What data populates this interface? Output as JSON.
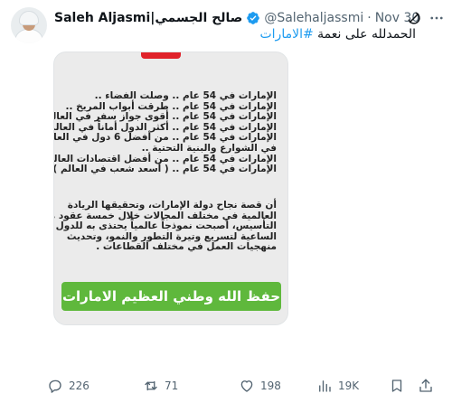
{
  "tweet": {
    "author_name": "Saleh Aljasmi|صالح الجسمي",
    "handle": "@Salehaljassmi",
    "separator": "·",
    "date": "Nov 30",
    "text_prefix": "الحمدلله على نعمة",
    "hashtag": "#الامارات"
  },
  "card": {
    "lines": [
      "الإمارات في 54 عام .. وصلت الفضاء ..",
      "الإمارات في 54 عام .. طرقت أبواب المريخ ..",
      "الإمارات في 54 عام .. أقوى جواز سفر في العالم ..",
      "الإمارات في 54 عام .. أكثر الدول أماناً في العالم ..",
      "الإمارات في 54 عام .. من أفضل 6 دول في العالم",
      "في الشوارع والبنية التحتية ..",
      "الإمارات في 54 عام .. من أفضل اقتصادات العالم",
      "الإمارات في 54 عام .. ( أسعد شعب في العالم )"
    ],
    "paragraph": [
      "أن قصة نجاح دولة الإمارات، وتحقيقها الريادة",
      "العالمية في مختلف المجالات خلال خمسة عقود من",
      "التأسيس، أصبحت نموذجاً عالمياً يحتذى به للدول",
      "الساعية لتسريع وتيرة التطور والنمو، وتحديث",
      "منهجيات العمل في مختلف القطاعات ."
    ],
    "banner": "حفظ الله وطني العظيم الامارات"
  },
  "actions": {
    "replies": "226",
    "reposts": "71",
    "likes": "198",
    "views": "19K"
  },
  "icons": {
    "verified": "verified-badge-icon",
    "grok": "grok-icon",
    "more": "more-icon",
    "reply": "reply-icon",
    "repost": "repost-icon",
    "like": "heart-icon",
    "views": "views-icon",
    "bookmark": "bookmark-icon",
    "share": "share-icon"
  },
  "colors": {
    "accent": "#1d9bf0",
    "muted": "#536471",
    "banner_green": "#5fb83c",
    "card_bg": "#ebebeb",
    "top_red": "#e0232b"
  }
}
